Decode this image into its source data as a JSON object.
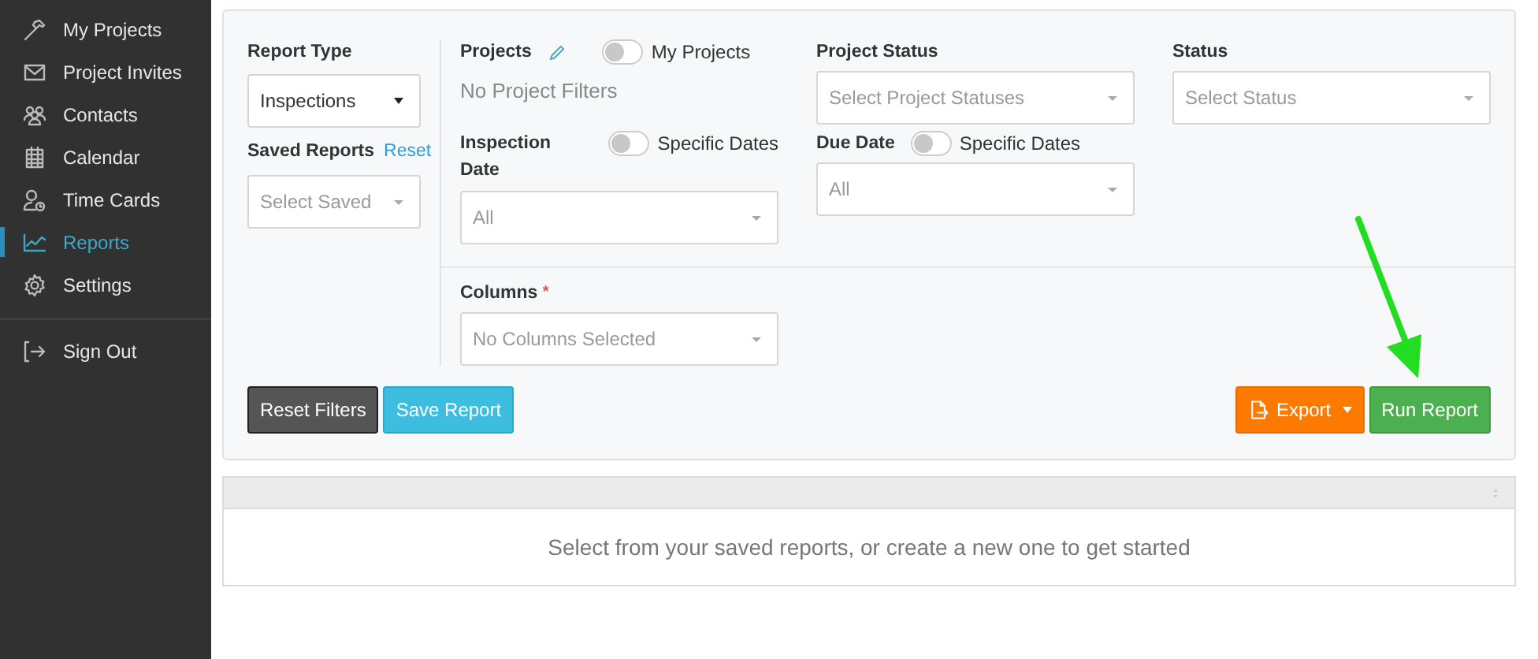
{
  "sidebar": {
    "items": [
      {
        "label": "My Projects",
        "selected": false
      },
      {
        "label": "Project Invites",
        "selected": false
      },
      {
        "label": "Contacts",
        "selected": false
      },
      {
        "label": "Calendar",
        "selected": false
      },
      {
        "label": "Time Cards",
        "selected": false
      },
      {
        "label": "Reports",
        "selected": true
      },
      {
        "label": "Settings",
        "selected": false
      }
    ],
    "footer_items": [
      {
        "label": "Sign Out",
        "selected": false
      }
    ]
  },
  "filters": {
    "report_type": {
      "label": "Report Type",
      "value": "Inspections"
    },
    "saved_reports": {
      "label": "Saved Reports",
      "link": "Reset",
      "placeholder": "Select Saved"
    },
    "projects": {
      "label": "Projects",
      "toggle_label": "My Projects",
      "toggle_on": false,
      "empty_text": "No Project Filters"
    },
    "inspection_date": {
      "label": "Inspection Date",
      "toggle_label": "Specific Dates",
      "toggle_on": false,
      "placeholder": "All"
    },
    "columns": {
      "label": "Columns",
      "required": true,
      "required_mark": "*",
      "placeholder": "No Columns Selected"
    },
    "project_status": {
      "label": "Project Status",
      "placeholder": "Select Project Statuses"
    },
    "due_date": {
      "label": "Due Date",
      "toggle_label": "Specific Dates",
      "toggle_on": false,
      "placeholder": "All"
    },
    "status": {
      "label": "Status",
      "placeholder": "Select Status"
    }
  },
  "buttons": {
    "reset_filters": "Reset Filters",
    "save_report": "Save Report",
    "export": "Export",
    "run_report": "Run Report"
  },
  "results": {
    "message": "Select from your saved reports, or create a new one to get started"
  }
}
